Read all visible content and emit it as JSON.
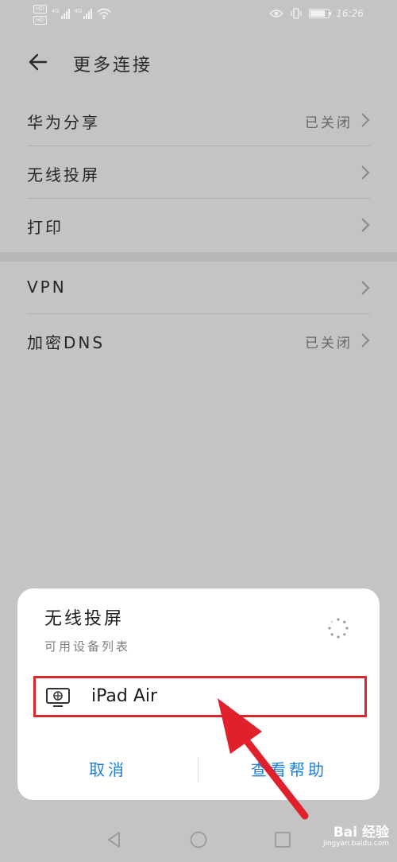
{
  "status_bar": {
    "hd_badges": [
      "HD",
      "HD"
    ],
    "network_1": "4G",
    "network_2": "4G",
    "battery_level": "79",
    "battery_fraction": 0.79,
    "time": "16:26"
  },
  "header": {
    "title": "更多连接"
  },
  "settings": {
    "items": [
      {
        "label": "华为分享",
        "value": "已关闭"
      },
      {
        "label": "无线投屏",
        "value": ""
      },
      {
        "label": "打印",
        "value": ""
      },
      {
        "label": "VPN",
        "value": ""
      },
      {
        "label": "加密DNS",
        "value": "已关闭"
      }
    ]
  },
  "dialog": {
    "title": "无线投屏",
    "subtitle": "可用设备列表",
    "device_name": "iPad Air",
    "cancel_label": "取消",
    "help_label": "查看帮助"
  },
  "watermark": {
    "main": "Bai 经验",
    "sub": "jingyan.baidu.com"
  },
  "colors": {
    "accent": "#1b7fd9",
    "highlight": "#d9262d",
    "overlay": "#c4c4c4"
  }
}
